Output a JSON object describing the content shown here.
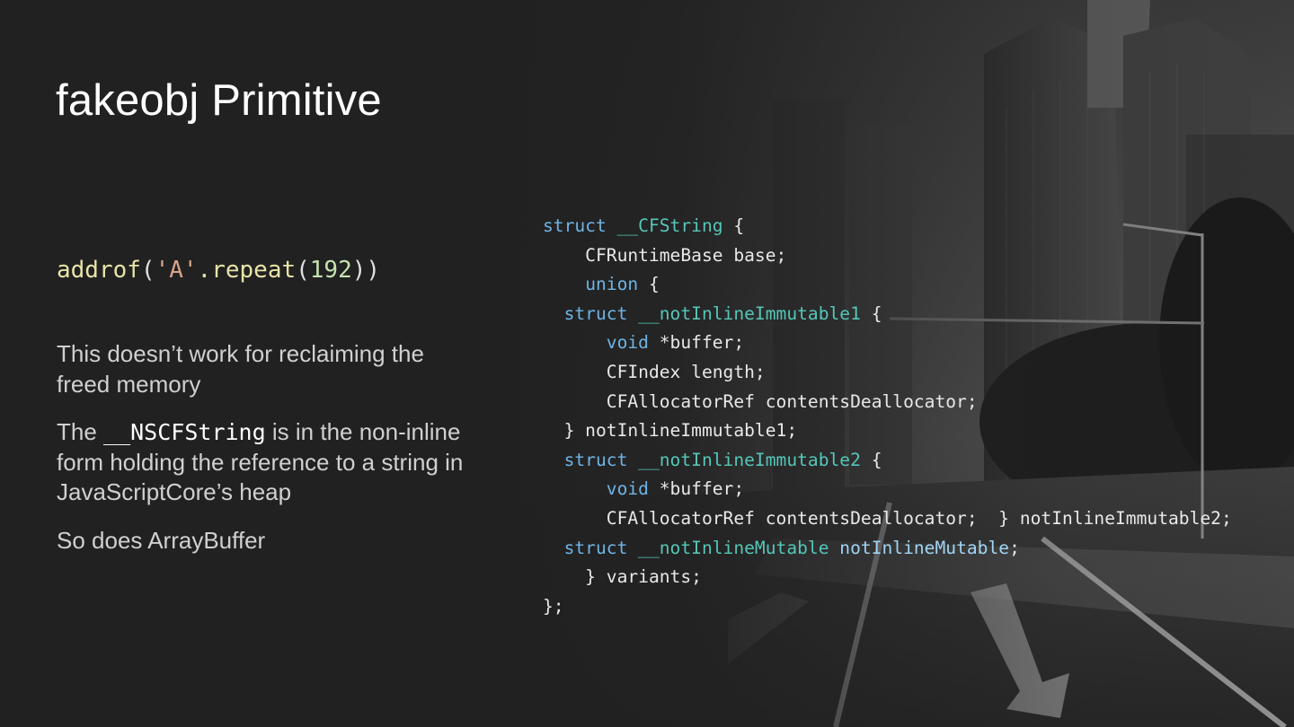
{
  "slide": {
    "title": "fakeobj Primitive",
    "call": {
      "fn": "addrof",
      "open": "(",
      "str": "'A'",
      "method": ".repeat",
      "open2": "(",
      "num": "192",
      "close": "))"
    },
    "paragraphs": {
      "p1": "This doesn’t work for reclaiming the freed memory",
      "p2_before": "The ",
      "p2_code": "__NSCFString",
      "p2_after": " is in the non-inline form holding the reference to a string in JavaScriptCore’s heap",
      "p3": "So does ArrayBuffer"
    },
    "code": {
      "l1_kw": "struct",
      "l1_ty": " __CFString",
      "l1_rest": " {",
      "l2": "    CFRuntimeBase base;",
      "l3_indent": "    ",
      "l3_kw": "union",
      "l3_rest": " {",
      "l4_indent": "  ",
      "l4_kw": "struct",
      "l4_ty": " __notInlineImmutable1",
      "l4_rest": " {",
      "l5_indent": "      ",
      "l5_kw": "void",
      "l5_rest": " *buffer;",
      "l6": "      CFIndex length;",
      "l7": "      CFAllocatorRef contentsDeallocator;",
      "l8": "  } notInlineImmutable1;",
      "l9_indent": "  ",
      "l9_kw": "struct",
      "l9_ty": " __notInlineImmutable2",
      "l9_rest": " {",
      "l10_indent": "      ",
      "l10_kw": "void",
      "l10_rest": " *buffer;",
      "l11": "      CFAllocatorRef contentsDeallocator;  } notInlineImmutable2;",
      "l12_indent": "  ",
      "l12_kw": "struct",
      "l12_ty": " __notInlineMutable",
      "l12_var": " notInlineMutable",
      "l12_rest": ";",
      "l13": "    } variants;",
      "l14": "};"
    }
  }
}
